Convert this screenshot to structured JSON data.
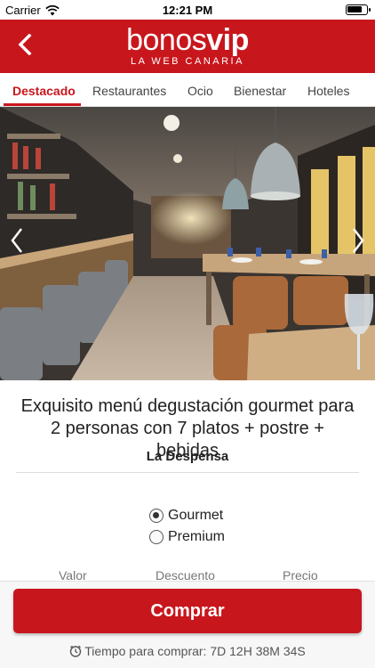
{
  "status_bar": {
    "carrier": "Carrier",
    "time": "12:21 PM",
    "battery_level": 0.8
  },
  "header": {
    "logo_part1": "bonos",
    "logo_part2": "vip",
    "logo_tagline": "LA WEB CANARIA",
    "brand_color": "#c8161d",
    "back_icon": "chevron-left-icon"
  },
  "tabs": [
    {
      "label": "Destacado",
      "active": true
    },
    {
      "label": "Restaurantes",
      "active": false
    },
    {
      "label": "Ocio",
      "active": false
    },
    {
      "label": "Bienestar",
      "active": false
    },
    {
      "label": "Hoteles",
      "active": false
    }
  ],
  "deal": {
    "title": "Exquisito menú degustación gourmet para 2 personas con 7 platos + postre + bebidas",
    "venue": "La Despensa",
    "options": [
      {
        "label": "Gourmet",
        "selected": true
      },
      {
        "label": "Premium",
        "selected": false
      }
    ],
    "price_headers": {
      "value": "Valor",
      "discount": "Descuento",
      "price": "Precio"
    }
  },
  "footer": {
    "buy_label": "Comprar",
    "timer_text": "Tiempo para comprar: 7D 12H 38M 34S",
    "timer_icon": "clock-icon"
  }
}
